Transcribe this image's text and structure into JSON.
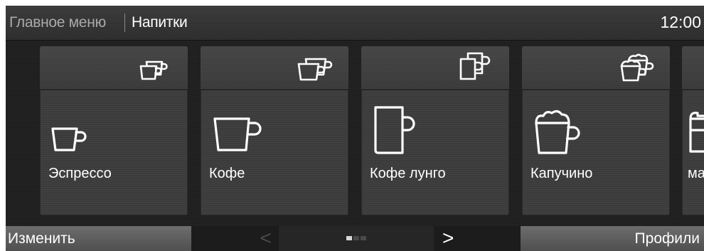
{
  "header": {
    "breadcrumb_main": "Главное меню",
    "breadcrumb_current": "Напитки",
    "clock": "12:00"
  },
  "tiles": [
    {
      "label": "Эспрессо",
      "top_icon": "double-espresso-cups-icon",
      "main_icon": "espresso-cup-icon"
    },
    {
      "label": "Кофе",
      "top_icon": "double-coffee-cups-icon",
      "main_icon": "coffee-cup-icon"
    },
    {
      "label": "Кофе лунго",
      "top_icon": "double-lungo-mugs-icon",
      "main_icon": "lungo-mug-icon"
    },
    {
      "label": "Капучино",
      "top_icon": "double-cappuccino-cups-icon",
      "main_icon": "cappuccino-cup-icon"
    },
    {
      "label": "ма",
      "top_icon": "",
      "main_icon": "macchiato-glass-icon"
    }
  ],
  "bottom_bar": {
    "edit_label": "Изменить",
    "prev_label": "<",
    "next_label": ">",
    "profiles_label": "Профили",
    "page_count": 3,
    "active_page": 1
  },
  "colors": {
    "background": "#1f1f1f",
    "tile": "#3b3b3b",
    "button": "#5e5e5e",
    "text": "#ffffff"
  }
}
